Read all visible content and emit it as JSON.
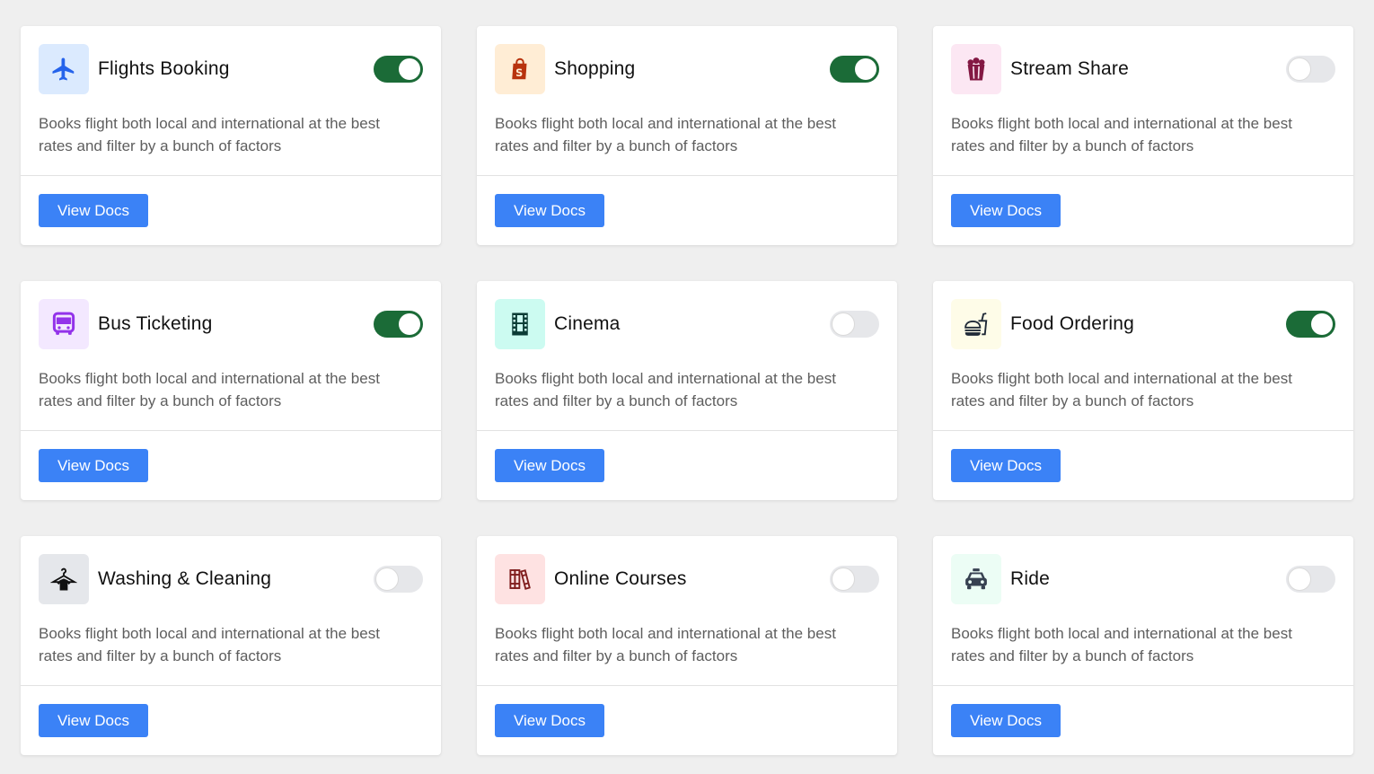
{
  "colors": {
    "toggle_on": "#1b6b37",
    "toggle_off": "#e6e7ea",
    "button": "#3b82f6",
    "page_background": "#efefef"
  },
  "cards": [
    {
      "title": "Flights Booking",
      "description": "Books flight both local and international at the best rates and filter by a bunch of factors",
      "button_label": "View Docs",
      "enabled": true,
      "icon": "airplane-icon",
      "icon_bg": "#dbeafe",
      "icon_color": "#2563eb"
    },
    {
      "title": "Shopping",
      "description": "Books flight both local and international at the best rates and filter by a bunch of factors",
      "button_label": "View Docs",
      "enabled": true,
      "icon": "shopping-bag-icon",
      "icon_bg": "#ffedd5",
      "icon_color": "#b8330e"
    },
    {
      "title": "Stream Share",
      "description": "Books flight both local and international at the best rates and filter by a bunch of factors",
      "button_label": "View Docs",
      "enabled": false,
      "icon": "popcorn-icon",
      "icon_bg": "#fce7f3",
      "icon_color": "#831843"
    },
    {
      "title": "Bus Ticketing",
      "description": "Books flight both local and international at the best rates and filter by a bunch of factors",
      "button_label": "View Docs",
      "enabled": true,
      "icon": "bus-icon",
      "icon_bg": "#f3e8ff",
      "icon_color": "#9333ea"
    },
    {
      "title": "Cinema",
      "description": "Books flight both local and international at the best rates and filter by a bunch of factors",
      "button_label": "View Docs",
      "enabled": false,
      "icon": "film-strip-icon",
      "icon_bg": "#ccfbf1",
      "icon_color": "#0b3b35"
    },
    {
      "title": "Food Ordering",
      "description": "Books flight both local and international at the best rates and filter by a bunch of factors",
      "button_label": "View Docs",
      "enabled": true,
      "icon": "burger-drink-icon",
      "icon_bg": "#fefce8",
      "icon_color": "#1f2937"
    },
    {
      "title": "Washing & Cleaning",
      "description": "Books flight both local and international at the best rates and filter by a bunch of factors",
      "button_label": "View Docs",
      "enabled": false,
      "icon": "hanger-shirt-icon",
      "icon_bg": "#e5e7eb",
      "icon_color": "#111111"
    },
    {
      "title": "Online Courses",
      "description": "Books flight both local and international at the best rates and filter by a bunch of factors",
      "button_label": "View Docs",
      "enabled": false,
      "icon": "books-icon",
      "icon_bg": "#fee2e2",
      "icon_color": "#7f1d1d"
    },
    {
      "title": "Ride",
      "description": "Books flight both local and international at the best rates and filter by a bunch of factors",
      "button_label": "View Docs",
      "enabled": false,
      "icon": "car-icon",
      "icon_bg": "#ecfdf5",
      "icon_color": "#374151"
    }
  ]
}
